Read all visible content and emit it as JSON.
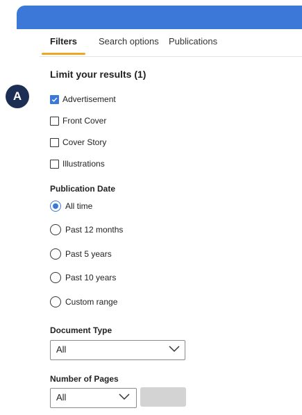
{
  "tabs": [
    {
      "label": "Filters",
      "active": true
    },
    {
      "label": "Search options",
      "active": false
    },
    {
      "label": "Publications",
      "active": false
    }
  ],
  "annotation_badge": "A",
  "limit": {
    "title": "Limit your results (1)",
    "options": [
      {
        "label": "Advertisement",
        "checked": true
      },
      {
        "label": "Front Cover",
        "checked": false
      },
      {
        "label": "Cover Story",
        "checked": false
      },
      {
        "label": "Illustrations",
        "checked": false
      }
    ]
  },
  "publication_date": {
    "title": "Publication Date",
    "options": [
      {
        "label": "All time",
        "selected": true
      },
      {
        "label": "Past 12 months",
        "selected": false
      },
      {
        "label": "Past 5 years",
        "selected": false
      },
      {
        "label": "Past 10 years",
        "selected": false
      },
      {
        "label": "Custom range",
        "selected": false
      }
    ]
  },
  "document_type": {
    "title": "Document Type",
    "value": "All"
  },
  "number_of_pages": {
    "title": "Number of Pages",
    "value": "All"
  },
  "colors": {
    "accent": "#3b78d8",
    "tab_indicator": "#f0a623",
    "badge": "#1d2e54"
  }
}
